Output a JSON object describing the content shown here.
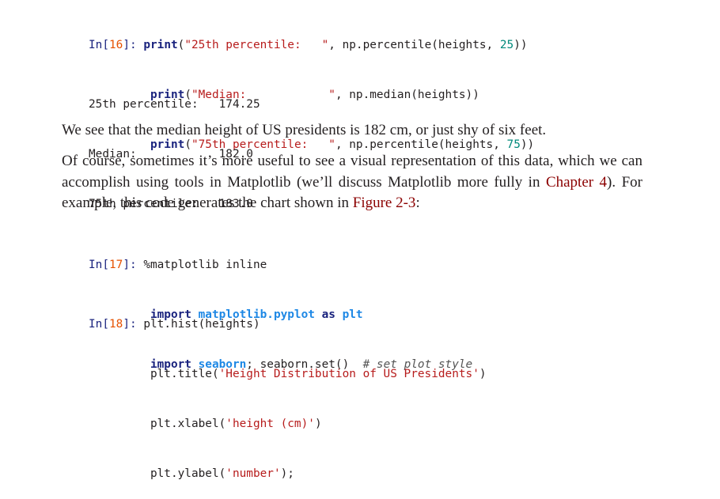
{
  "cell16": {
    "prompt_pre": "In[",
    "prompt_num": "16",
    "prompt_post": "]: ",
    "indent": "         ",
    "lines": [
      {
        "fn": "print",
        "open": "(",
        "str": "\"25th percentile:   \"",
        "rest": ", np.percentile(heights, ",
        "num": "25",
        "close": "))"
      },
      {
        "fn": "print",
        "open": "(",
        "str": "\"Median:            \"",
        "rest": ", np.median(heights))",
        "num": "",
        "close": ""
      },
      {
        "fn": "print",
        "open": "(",
        "str": "\"75th percentile:   \"",
        "rest": ", np.percentile(heights, ",
        "num": "75",
        "close": "))"
      }
    ]
  },
  "output16": [
    {
      "label": "25th percentile:   ",
      "value": "174.25"
    },
    {
      "label": "Median:            ",
      "value": "182.0"
    },
    {
      "label": "75th percentile:   ",
      "value": "183.0"
    }
  ],
  "prose1": "We see that the median height of US presidents is 182 cm, or just shy of six feet.",
  "prose2": {
    "part1": "Of course, sometimes it’s more useful to see a visual representation of this data, which we can accomplish using tools in Matplotlib (we’ll discuss Matplotlib more fully in ",
    "link1": "Chapter 4",
    "part2": "). For example, this code generates the chart shown in ",
    "link2": "Figure 2-3",
    "part3": ":"
  },
  "cell17": {
    "prompt_pre": "In[",
    "prompt_num": "17",
    "prompt_post": "]: ",
    "indent": "         ",
    "line1": "%matplotlib inline",
    "line2": {
      "kw1": "import",
      "mod1": "matplotlib.pyplot",
      "kw2": "as",
      "mod2": "plt"
    },
    "line3": {
      "kw1": "import",
      "mod1": "seaborn",
      "rest": "; seaborn.set()  ",
      "comment": "# set plot style"
    }
  },
  "cell18": {
    "prompt_pre": "In[",
    "prompt_num": "18",
    "prompt_post": "]: ",
    "indent": "         ",
    "line1": "plt.hist(heights)",
    "line2": {
      "pre": "plt.title(",
      "str": "'Height Distribution of US Presidents'",
      "post": ")"
    },
    "line3": {
      "pre": "plt.xlabel(",
      "str": "'height (cm)'",
      "post": ")"
    },
    "line4": {
      "pre": "plt.ylabel(",
      "str": "'number'",
      "post": ");"
    }
  }
}
